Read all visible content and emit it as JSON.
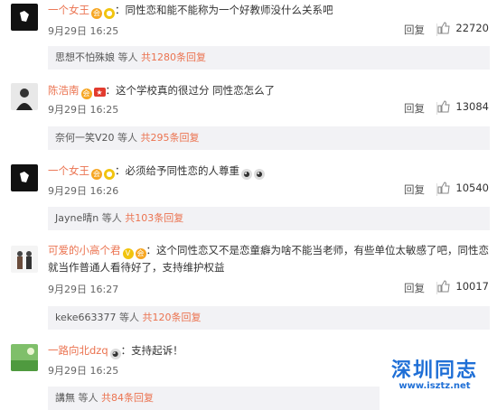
{
  "reply_label": "回复",
  "comments": [
    {
      "user": "一个女王",
      "text": "：同性恋和能不能称为一个好教师没什么关系吧",
      "date": "9月29日 16:25",
      "likes": "22720",
      "reply_preview": {
        "name": "思想不怕殊娘",
        "suffix": " 等人 ",
        "count": "共1280条回复"
      }
    },
    {
      "user": "陈浩南",
      "text": "：这个学校真的很过分 同性恋怎么了",
      "date": "9月29日 16:25",
      "likes": "13084",
      "reply_preview": {
        "name": "奈何一笑V20",
        "suffix": " 等人 ",
        "count": "共295条回复"
      }
    },
    {
      "user": "一个女王",
      "text": "：必须给予同性恋的人尊重",
      "date": "9月29日 16:26",
      "likes": "10540",
      "reply_preview": {
        "name": "Jayne晴n",
        "suffix": " 等人 ",
        "count": "共103条回复"
      }
    },
    {
      "user": "可爱的小高个君",
      "text": "：这个同性恋又不是恋童癖为啥不能当老师，有些单位太敏感了吧，同性恋就当作普通人看待好了，支持维护权益",
      "date": "9月29日 16:27",
      "likes": "10017",
      "reply_preview": {
        "name": "keke663377",
        "suffix": " 等人 ",
        "count": "共120条回复"
      }
    },
    {
      "user": "一路向北dzq",
      "text": "：支持起诉！",
      "date": "9月29日 16:25",
      "likes": "",
      "reply_preview": {
        "name": "講無",
        "suffix": " 等人 ",
        "count": "共84条回复"
      }
    }
  ],
  "watermark": {
    "title": "深圳同志",
    "url": "www.isztz.net"
  },
  "colors": {
    "username": "#eb7350",
    "watermark": "#1f6fd6",
    "reply_box": "#f2f2f5"
  }
}
